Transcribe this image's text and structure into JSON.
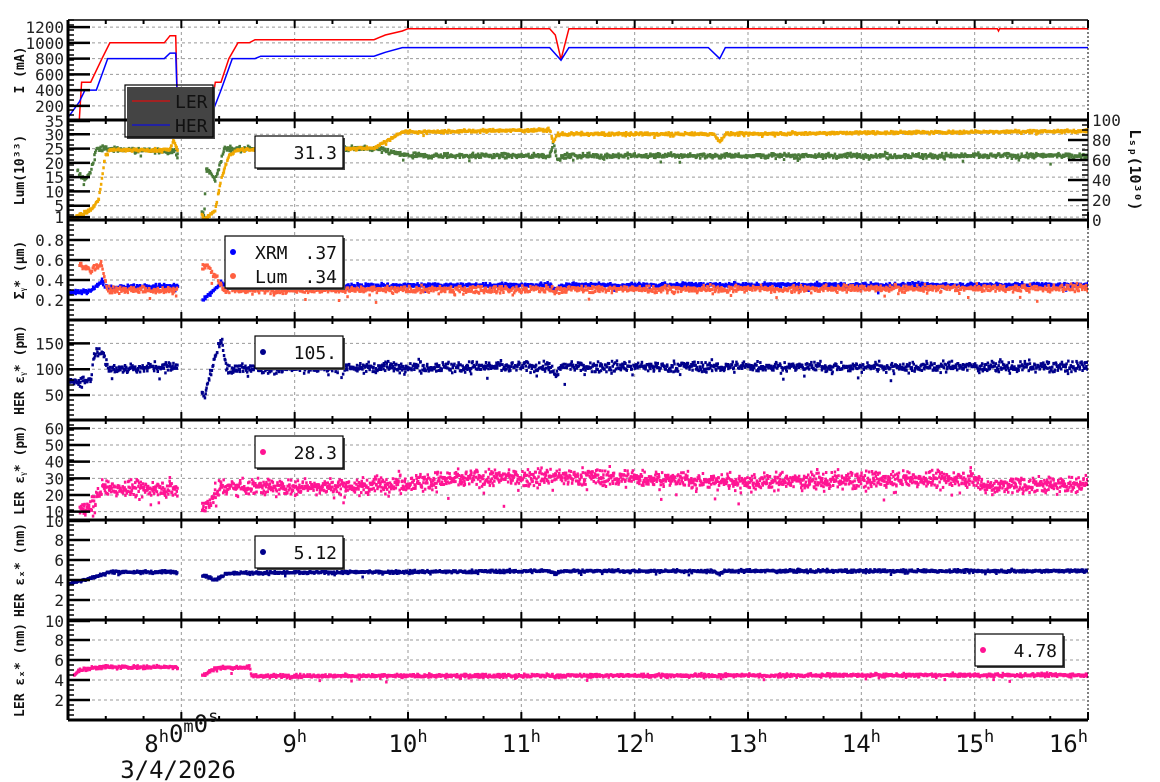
{
  "chart_data": {
    "type": "line",
    "title": "",
    "xlabel": "3/4/2026",
    "x_unit": "hours",
    "xlim": [
      7.0,
      16.0
    ],
    "x_ticks": [
      {
        "value": 8,
        "label": "8h0m0s"
      },
      {
        "value": 9,
        "label": "9h"
      },
      {
        "value": 10,
        "label": "10h"
      },
      {
        "value": 11,
        "label": "11h"
      },
      {
        "value": 12,
        "label": "12h"
      },
      {
        "value": 13,
        "label": "13h"
      },
      {
        "value": 14,
        "label": "14h"
      },
      {
        "value": 15,
        "label": "15h"
      },
      {
        "value": 16,
        "label": "16h"
      }
    ],
    "date_label": "3/4/2026",
    "grid": true,
    "gaps": [
      [
        7.97,
        8.18
      ]
    ],
    "panels": [
      {
        "ylabel": "I (mA)",
        "ylim": [
          20,
          1290
        ],
        "yticks": [
          200,
          400,
          600,
          800,
          1000,
          1200
        ],
        "legend": {
          "placement": "top-left",
          "entries": [
            {
              "label": "LER",
              "value": ""
            },
            {
              "label": "HER",
              "value": ""
            }
          ]
        },
        "series": [
          {
            "name": "LER",
            "kind": "line",
            "color": "#ff0000",
            "noise": 0,
            "points": [
              [
                7.0,
                20
              ],
              [
                7.1,
                20
              ],
              [
                7.12,
                500
              ],
              [
                7.2,
                500
              ],
              [
                7.3,
                800
              ],
              [
                7.37,
                1000
              ],
              [
                7.85,
                1000
              ],
              [
                7.9,
                1090
              ],
              [
                7.95,
                1090
              ],
              [
                7.97,
                30
              ],
              [
                8.25,
                30
              ],
              [
                8.3,
                500
              ],
              [
                8.35,
                500
              ],
              [
                8.42,
                800
              ],
              [
                8.5,
                1000
              ],
              [
                8.6,
                1000
              ],
              [
                8.65,
                1040
              ],
              [
                9.7,
                1040
              ],
              [
                9.8,
                1100
              ],
              [
                9.95,
                1150
              ],
              [
                10.0,
                1180
              ],
              [
                11.25,
                1180
              ],
              [
                11.3,
                1100
              ],
              [
                11.35,
                790
              ],
              [
                11.42,
                1180
              ],
              [
                15.2,
                1180
              ],
              [
                15.21,
                1150
              ],
              [
                15.22,
                1180
              ],
              [
                16.0,
                1180
              ]
            ]
          },
          {
            "name": "HER",
            "kind": "line",
            "color": "#0000ff",
            "noise": 0,
            "points": [
              [
                7.0,
                50
              ],
              [
                7.1,
                250
              ],
              [
                7.15,
                400
              ],
              [
                7.25,
                400
              ],
              [
                7.35,
                800
              ],
              [
                7.85,
                800
              ],
              [
                7.9,
                870
              ],
              [
                7.95,
                870
              ],
              [
                7.97,
                30
              ],
              [
                8.25,
                30
              ],
              [
                8.35,
                400
              ],
              [
                8.45,
                800
              ],
              [
                8.65,
                800
              ],
              [
                8.7,
                830
              ],
              [
                9.7,
                830
              ],
              [
                9.8,
                880
              ],
              [
                9.95,
                940
              ],
              [
                11.25,
                940
              ],
              [
                11.35,
                780
              ],
              [
                11.42,
                940
              ],
              [
                12.65,
                940
              ],
              [
                12.75,
                800
              ],
              [
                12.8,
                940
              ],
              [
                16.0,
                940
              ]
            ]
          }
        ]
      },
      {
        "ylabel": "Lum(10³³)",
        "ylim": [
          0,
          35
        ],
        "yticks": [
          1,
          5,
          10,
          15,
          20,
          25,
          30,
          35
        ],
        "right_axis": {
          "label": "Lₛₚ(10³⁰)",
          "ylim": [
            0,
            100
          ],
          "ticks": [
            0,
            20,
            40,
            60,
            80,
            100
          ]
        },
        "legend": {
          "placement": "top-center",
          "entries": [
            {
              "label": "",
              "value": "31.3"
            }
          ]
        },
        "series": [
          {
            "name": "Lum",
            "kind": "scatter",
            "axis": "left",
            "color": "#4a7a3a",
            "noise": 0.6,
            "n": 1400,
            "points": [
              [
                7.08,
                17
              ],
              [
                7.15,
                14
              ],
              [
                7.2,
                17
              ],
              [
                7.25,
                25
              ],
              [
                7.95,
                24
              ],
              [
                8.2,
                1
              ],
              [
                8.22,
                18
              ],
              [
                8.3,
                14
              ],
              [
                8.38,
                25
              ],
              [
                9.7,
                25
              ],
              [
                10.0,
                22.5
              ],
              [
                11.25,
                22.5
              ],
              [
                11.28,
                27
              ],
              [
                11.32,
                21
              ],
              [
                11.4,
                22.5
              ],
              [
                16.0,
                22.5
              ]
            ]
          },
          {
            "name": "Lsp",
            "kind": "scatter",
            "axis": "right",
            "color": "#f0a800",
            "noise": 1.0,
            "n": 1400,
            "points": [
              [
                7.0,
                0
              ],
              [
                7.1,
                5
              ],
              [
                7.2,
                10
              ],
              [
                7.27,
                20
              ],
              [
                7.33,
                65
              ],
              [
                7.37,
                70
              ],
              [
                7.9,
                70
              ],
              [
                7.93,
                80
              ],
              [
                8.2,
                0
              ],
              [
                8.3,
                10
              ],
              [
                8.35,
                40
              ],
              [
                8.42,
                65
              ],
              [
                8.5,
                70
              ],
              [
                9.7,
                72
              ],
              [
                9.95,
                88
              ],
              [
                11.25,
                90
              ],
              [
                11.28,
                78
              ],
              [
                11.32,
                86
              ],
              [
                12.7,
                86
              ],
              [
                12.75,
                78
              ],
              [
                12.8,
                86
              ],
              [
                16.0,
                89
              ]
            ]
          }
        ]
      },
      {
        "ylabel": "Σᵧ* (μm)",
        "ylim": [
          0,
          1
        ],
        "yticks": [
          0.2,
          0.4,
          0.6,
          0.8
        ],
        "legend": {
          "placement": "top-left",
          "entries": [
            {
              "label": "XRM",
              "value": ".37",
              "color": "#0000ff"
            },
            {
              "label": "Lum",
              "value": ".34",
              "color": "#ff6040"
            }
          ]
        },
        "series": [
          {
            "name": "XRM",
            "kind": "scatter",
            "color": "#0000ff",
            "noise": 0.015,
            "n": 1500,
            "points": [
              [
                7.0,
                0.27
              ],
              [
                7.2,
                0.3
              ],
              [
                7.3,
                0.38
              ],
              [
                7.35,
                0.33
              ],
              [
                7.95,
                0.34
              ],
              [
                8.2,
                0.2
              ],
              [
                8.35,
                0.37
              ],
              [
                8.4,
                0.34
              ],
              [
                11.25,
                0.35
              ],
              [
                11.3,
                0.3
              ],
              [
                11.35,
                0.35
              ],
              [
                16.0,
                0.35
              ]
            ]
          },
          {
            "name": "Lum",
            "kind": "scatter",
            "color": "#ff6040",
            "noise": 0.025,
            "n": 1500,
            "points": [
              [
                7.1,
                0.55
              ],
              [
                7.2,
                0.5
              ],
              [
                7.3,
                0.55
              ],
              [
                7.35,
                0.3
              ],
              [
                7.95,
                0.3
              ],
              [
                8.22,
                0.55
              ],
              [
                8.3,
                0.45
              ],
              [
                8.38,
                0.3
              ],
              [
                16.0,
                0.32
              ]
            ]
          }
        ]
      },
      {
        "ylabel": "HER εᵧ* (pm)",
        "ylim": [
          2,
          195
        ],
        "yticks": [
          50,
          100,
          150
        ],
        "legend": {
          "placement": "top-center",
          "entries": [
            {
              "label": "",
              "value": "105.",
              "color": "#00008b"
            }
          ]
        },
        "series": [
          {
            "name": "HER εy*",
            "kind": "scatter",
            "color": "#00008b",
            "noise": 7,
            "n": 1600,
            "points": [
              [
                7.0,
                75
              ],
              [
                7.2,
                80
              ],
              [
                7.23,
                130
              ],
              [
                7.3,
                140
              ],
              [
                7.35,
                100
              ],
              [
                7.95,
                105
              ],
              [
                8.2,
                50
              ],
              [
                8.35,
                160
              ],
              [
                8.4,
                100
              ],
              [
                10.0,
                105
              ],
              [
                11.25,
                105
              ],
              [
                11.3,
                85
              ],
              [
                11.35,
                105
              ],
              [
                16.0,
                105
              ]
            ]
          }
        ]
      },
      {
        "ylabel": "LER εᵧ* (pm)",
        "ylim": [
          5,
          65
        ],
        "yticks": [
          10,
          20,
          30,
          40,
          50,
          60
        ],
        "legend": {
          "placement": "top-center",
          "entries": [
            {
              "label": "",
              "value": "28.3",
              "color": "#ff1493"
            }
          ]
        },
        "series": [
          {
            "name": "LER εy*",
            "kind": "scatter",
            "color": "#ff1493",
            "noise": 3.5,
            "n": 2200,
            "points": [
              [
                7.1,
                12
              ],
              [
                7.2,
                13
              ],
              [
                7.3,
                24
              ],
              [
                7.95,
                24
              ],
              [
                8.2,
                12
              ],
              [
                8.35,
                25
              ],
              [
                9.5,
                25
              ],
              [
                10.5,
                30
              ],
              [
                11.5,
                31
              ],
              [
                13.0,
                28
              ],
              [
                15.0,
                30
              ],
              [
                15.1,
                25
              ],
              [
                16.0,
                27
              ]
            ]
          }
        ]
      },
      {
        "ylabel": "HER εₓ* (nm)",
        "ylim": [
          0,
          10
        ],
        "yticks": [
          2,
          4,
          6,
          8,
          10
        ],
        "legend": {
          "placement": "top-center",
          "entries": [
            {
              "label": "",
              "value": "5.12",
              "color": "#00008b"
            }
          ]
        },
        "series": [
          {
            "name": "HER εx*",
            "kind": "scatter",
            "color": "#00008b",
            "noise": 0.1,
            "n": 1600,
            "points": [
              [
                7.0,
                3.6
              ],
              [
                7.3,
                4.5
              ],
              [
                7.35,
                4.8
              ],
              [
                7.95,
                4.8
              ],
              [
                8.2,
                4.5
              ],
              [
                8.3,
                4.0
              ],
              [
                8.4,
                4.7
              ],
              [
                11.25,
                4.9
              ],
              [
                11.3,
                4.6
              ],
              [
                11.35,
                4.9
              ],
              [
                12.7,
                4.9
              ],
              [
                12.75,
                4.6
              ],
              [
                12.8,
                4.9
              ],
              [
                16.0,
                4.9
              ]
            ]
          }
        ]
      },
      {
        "ylabel": "LER εₓ* (nm)",
        "ylim": [
          0,
          10
        ],
        "yticks": [
          2,
          4,
          6,
          8,
          10
        ],
        "legend": {
          "placement": "top-right",
          "entries": [
            {
              "label": "",
              "value": "4.78",
              "color": "#ff1493"
            }
          ]
        },
        "series": [
          {
            "name": "LER εx*",
            "kind": "scatter",
            "color": "#ff1493",
            "noise": 0.12,
            "n": 1600,
            "points": [
              [
                7.05,
                4.5
              ],
              [
                7.1,
                5.0
              ],
              [
                7.3,
                5.3
              ],
              [
                7.95,
                5.3
              ],
              [
                8.2,
                4.5
              ],
              [
                8.3,
                5.2
              ],
              [
                8.6,
                5.3
              ],
              [
                8.62,
                4.4
              ],
              [
                16.0,
                4.5
              ]
            ]
          }
        ]
      }
    ]
  }
}
